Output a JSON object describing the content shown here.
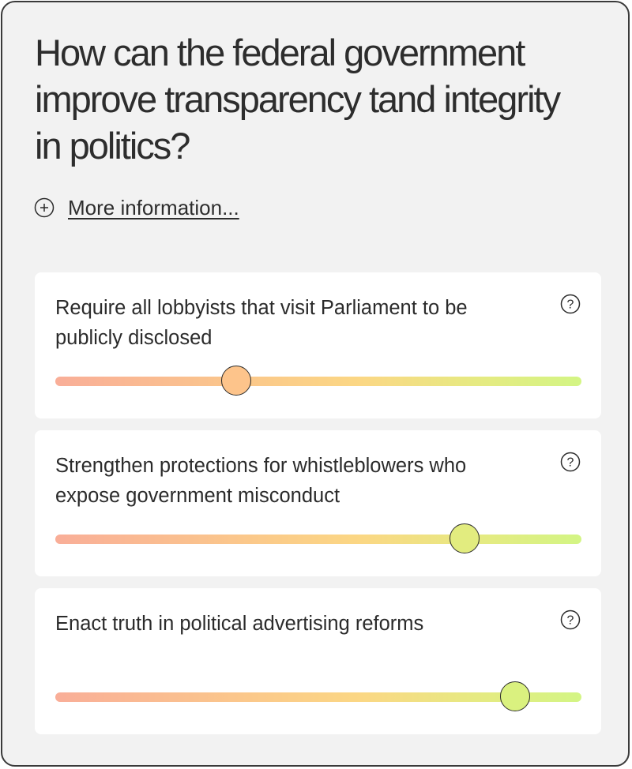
{
  "question": {
    "title": "How can the federal government improve transparency tand integrity in politics?"
  },
  "more_info": {
    "label": "More information...",
    "icon": "plus-circle-icon"
  },
  "statements": [
    {
      "text": "Require all lobbyists that visit Parliament to be publicly disclosed",
      "value": 0.345,
      "thumb_color": "#fdc48b",
      "help_icon": "question-circle-icon"
    },
    {
      "text": "Strengthen protections for whistleblowers who expose government misconduct",
      "value": 0.78,
      "thumb_color": "#e2ec7f",
      "help_icon": "question-circle-icon"
    },
    {
      "text": "Enact truth in political advertising reforms",
      "value": 0.875,
      "thumb_color": "#daf17f",
      "help_icon": "question-circle-icon"
    }
  ],
  "colors": {
    "frame_background": "#f2f2f2",
    "card_background": "#ffffff",
    "text": "#2b2b2b",
    "track_start": "#f9ae98",
    "track_middle": "#fbd784",
    "track_end": "#d3f584"
  }
}
